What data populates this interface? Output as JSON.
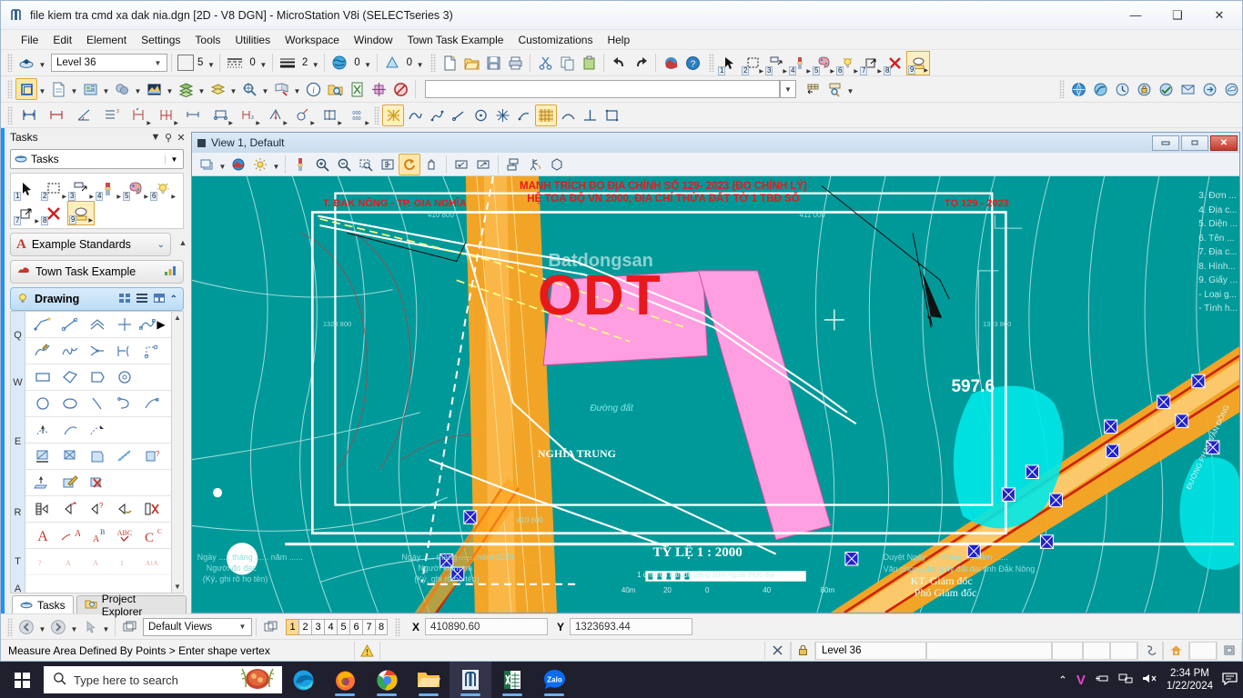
{
  "window": {
    "title": "file kiem tra cmd  xa dak nia.dgn [2D - V8 DGN] - MicroStation V8i (SELECTseries 3)",
    "app_icon": "microstation-icon",
    "minimize": "—",
    "maximize": "❑",
    "close": "✕"
  },
  "menubar": {
    "items": [
      {
        "label": "File"
      },
      {
        "label": "Edit"
      },
      {
        "label": "Element"
      },
      {
        "label": "Settings"
      },
      {
        "label": "Tools"
      },
      {
        "label": "Utilities"
      },
      {
        "label": "Workspace"
      },
      {
        "label": "Window"
      },
      {
        "label": "Town Task Example"
      },
      {
        "label": "Customizations"
      },
      {
        "label": "Help"
      }
    ]
  },
  "attributes_toolbar": {
    "level_value": "Level 36",
    "color_value": "5",
    "color_swatch": "#ff00ff",
    "style_value": "0",
    "weight_value": "2",
    "class_value": "0",
    "transparency_value": "0",
    "icons": [
      "active-level-icon",
      "color-icon",
      "line-style-icon",
      "line-weight-icon",
      "element-class-icon",
      "transparency-icon"
    ]
  },
  "standard_toolbar": {
    "icons": [
      "new-file-icon",
      "open-file-icon",
      "save-icon",
      "print-icon",
      "cut-icon",
      "copy-icon",
      "paste-icon",
      "undo-icon",
      "redo-icon",
      "render-icon",
      "help-icon"
    ]
  },
  "task_navigation_toolbar": {
    "icons": [
      "select-element-icon",
      "fence-icon",
      "copy-element-icon",
      "change-attributes-icon",
      "pattern-icon",
      "measure-icon",
      "move-icon",
      "delete-element-icon",
      "text-icon"
    ],
    "numbers": [
      "1",
      "2",
      "3",
      "4",
      "5",
      "6",
      "7",
      "8",
      "9"
    ]
  },
  "primary_toolbar": {
    "icons": [
      "models-icon",
      "references-icon",
      "raster-manager-icon",
      "point-cloud-icon",
      "terrain-model-icon",
      "level-manager-icon",
      "level-display-icon",
      "element-selection-icon",
      "fence-tool-icon",
      "element-info-icon",
      "find-replace-icon",
      "analyze-icon",
      "markup-icon",
      "clear-icon"
    ],
    "keyin_value": "",
    "keyin_placeholder": ""
  },
  "dimension_toolbar": {
    "icons": [
      "dimension-element-icon",
      "dimension-linear-icon",
      "dimension-angular-icon",
      "dimension-ordinate-icon",
      "dimension-size-arrow-icon",
      "dimension-size-stroke-icon",
      "dimension-location-icon",
      "dimension-stacked-icon",
      "dimension-angle-icon",
      "dimension-radial-icon",
      "dimension-diameter-icon",
      "dimension-geometry-icon",
      "dimension-settings-icon"
    ]
  },
  "draw_toolbar": {
    "icons": [
      "measure-area-icon",
      "place-smartline-icon",
      "place-line-icon",
      "place-arc-icon",
      "place-circle-icon",
      "place-ellipse-icon",
      "place-point-icon",
      "hatch-area-icon",
      "place-curve-icon",
      "perpendicular-icon",
      "place-block-icon"
    ],
    "active_icon": "hatch-area-icon"
  },
  "tasks_panel": {
    "title": "Tasks",
    "header_buttons": [
      "chevron-down-icon",
      "pin-icon",
      "close-icon"
    ],
    "selector_label": "Tasks",
    "selector_icon": "tasks-icon",
    "quick_tools": [
      {
        "num": "1",
        "name": "element-selection-icon"
      },
      {
        "num": "2",
        "name": "place-fence-icon"
      },
      {
        "num": "3",
        "name": "copy-element-icon"
      },
      {
        "num": "4",
        "name": "change-attributes-icon"
      },
      {
        "num": "5",
        "name": "pattern-icon"
      },
      {
        "num": "6",
        "name": "measure-icon"
      },
      {
        "num": "7",
        "name": "move-element-icon"
      },
      {
        "num": "8",
        "name": "delete-element-icon"
      },
      {
        "num": "9",
        "name": "place-text-icon"
      }
    ],
    "sections": [
      {
        "label": "Example Standards",
        "icon": "letter-a-icon",
        "chevron": "chevron-down-icon"
      },
      {
        "label": "Town Task Example",
        "icon": "town-icon",
        "chevron": "chart-icon"
      },
      {
        "label": "Drawing",
        "icon": "bulb-icon",
        "chevron": "chevron-up-icon"
      }
    ],
    "tool_groups": [
      {
        "key": "Q",
        "icons": [
          "place-smartline-icon",
          "place-line-icon",
          "place-multiline-icon",
          "place-point-icon",
          "place-curve-icon",
          "place-stream-icon",
          "place-point-curve-icon",
          "place-multi-line-icon",
          "construct-line-icon",
          "place-composite-icon"
        ]
      },
      {
        "key": "W",
        "icons": [
          "place-block-icon",
          "place-shape-icon",
          "place-orthogonal-shape-icon",
          "place-polygon-icon"
        ]
      },
      {
        "key": "E",
        "icons": [
          "place-circle-icon",
          "place-ellipse-icon",
          "place-arc-icon",
          "place-half-ellipse-icon",
          "place-quarter-ellipse-icon",
          "modify-arc-radius-icon",
          "modify-arc-angle-icon",
          "modify-arc-axis-icon"
        ]
      },
      {
        "key": "R",
        "icons": [
          "hatch-area-icon",
          "crosshatch-area-icon",
          "pattern-area-icon",
          "linear-pattern-icon",
          "show-pattern-attributes-icon",
          "match-pattern-icon",
          "change-pattern-icon",
          "delete-pattern-icon"
        ]
      },
      {
        "key": "T",
        "icons": [
          "place-cell-icon",
          "place-active-cell-matrix-icon",
          "identify-cell-icon",
          "replace-cell-icon",
          "drop-cell-icon"
        ]
      },
      {
        "key": "A",
        "icons": [
          "place-text-icon",
          "place-note-icon",
          "edit-text-icon",
          "spell-check-icon",
          "change-text-attributes-icon"
        ]
      }
    ],
    "tabs": [
      {
        "label": "Tasks",
        "icon": "tasks-icon",
        "selected": true
      },
      {
        "label": "Project Explorer",
        "icon": "explorer-icon",
        "selected": false
      }
    ]
  },
  "view_window": {
    "title": "View 1, Default",
    "minimize": "—",
    "maximize": "□",
    "close": "✕",
    "tools": [
      "view-attributes-icon",
      "view-display-style-icon",
      "adjust-brightness-icon",
      "update-view-icon",
      "zoom-in-icon",
      "zoom-out-icon",
      "window-area-icon",
      "fit-view-icon",
      "rotate-view-icon",
      "pan-view-icon",
      "view-previous-icon",
      "view-next-icon",
      "copy-view-icon",
      "change-view-perspective-icon",
      "clip-volume-icon"
    ],
    "active_tool": "rotate-view-icon"
  },
  "map": {
    "title_line1": "MANH TRÍCH ĐO ĐỊA CHÍNH SỐ 129- 2023 (ĐO CHÍNH LÝ)",
    "title_line2": "HỆ TOẠ ĐỘ VN 2000, ĐỊA CHỈ THỬA ĐẤT  TỜ 1 TBĐ SỐ",
    "region_label": "T. ĐAK NÔNG  -  TP. GIA NGHĨA",
    "sheet_code": "TỌ 129 - 2023",
    "parcel_type": "ODT",
    "village_label": "NGHĨA TRUNG",
    "road_label": "Đường đất",
    "elevation_label": "597.6",
    "scale_title": "TỶ LỆ 1 : 2000",
    "scale_note": "1 cm trên bản đồ bằng 20m ngoài thực địa",
    "scale_ticks": [
      "40m",
      "20",
      "0",
      "40",
      "80m"
    ],
    "grid_labels": [
      "410 800",
      "411 000",
      "410 600",
      "1323 800",
      "1323 800"
    ],
    "watermark": "Batdongsan",
    "sign_blocks": [
      {
        "line1": "Ngày ..... tháng ...... năm ......",
        "line2": "Người đo đạc",
        "line3": "(Ký, ghi rõ họ tên)"
      },
      {
        "line1": "Ngày ..... tháng ....... năm 2023",
        "line2": "Người kiểm tra",
        "line3": "(Ký, ghi rõ họ tên)"
      },
      {
        "line1": "Duyệt Ngày ..... tháng .... năm ......",
        "line2": "Văn phòng đăng ký đất đai tỉnh Đắk Nông",
        "line3": "KT. Giám đốc",
        "line4": "Phó Giám đốc"
      }
    ],
    "legend_items": [
      "3. Đơn ...",
      "4. Địa c...",
      "5. Diện ...",
      "6. Tên ...",
      "7. Địa c...",
      "8. Hình...",
      "9. Giấy ...",
      "- Loại g...",
      "- Tình h..."
    ],
    "vertical_road_label": "ĐƯỜNG PHẠM VĂN ĐỒNG",
    "colors": {
      "background": "#009999",
      "parcel_pink": "#ff9ee0",
      "road_orange": "#ffa420",
      "road_red": "#cc2200",
      "title_red": "#e8191c",
      "cyan": "#00f0f0",
      "marker_blue": "#2222cc"
    }
  },
  "view_status": {
    "back_icon": "back-arrow-icon",
    "forward_icon": "forward-arrow-icon",
    "pointer_icon": "pointer-icon",
    "views_label": "Default Views",
    "view_group_icon": "view-groups-icon",
    "view_numbers": [
      "1",
      "2",
      "3",
      "4",
      "5",
      "6",
      "7",
      "8"
    ],
    "active_view": "1",
    "x_label": "X",
    "x_value": "410890.60",
    "y_label": "Y",
    "y_value": "1323693.44"
  },
  "status_bar": {
    "message": "Measure Area Defined By Points > Enter shape vertex",
    "warning_icon": "warning-icon",
    "snap_icon": "snap-off-icon",
    "lock_icon": "lock-icon",
    "level_value": "Level 36",
    "empty_field": "",
    "right_icons": [
      "snap-mode-icon",
      "home-icon",
      "tool-settings-icon"
    ]
  },
  "taskbar": {
    "start_icon": "windows-start-icon",
    "search_placeholder": "Type here to search",
    "search_icon": "search-icon",
    "weather_icon": "food-widget-icon",
    "apps": [
      {
        "name": "edge-icon",
        "running": false
      },
      {
        "name": "firefox-icon",
        "running": true
      },
      {
        "name": "chrome-icon",
        "running": true
      },
      {
        "name": "file-explorer-icon",
        "running": true
      },
      {
        "name": "microstation-icon",
        "running": true,
        "selected": true
      },
      {
        "name": "excel-icon",
        "running": true
      },
      {
        "name": "zalo-icon",
        "running": true
      }
    ],
    "tray_icons": [
      "chevron-up-icon",
      "unikey-icon",
      "usb-icon",
      "network-icon",
      "volume-mute-icon"
    ],
    "time": "2:34 PM",
    "date": "1/22/2024",
    "notification_icon": "notification-icon"
  }
}
